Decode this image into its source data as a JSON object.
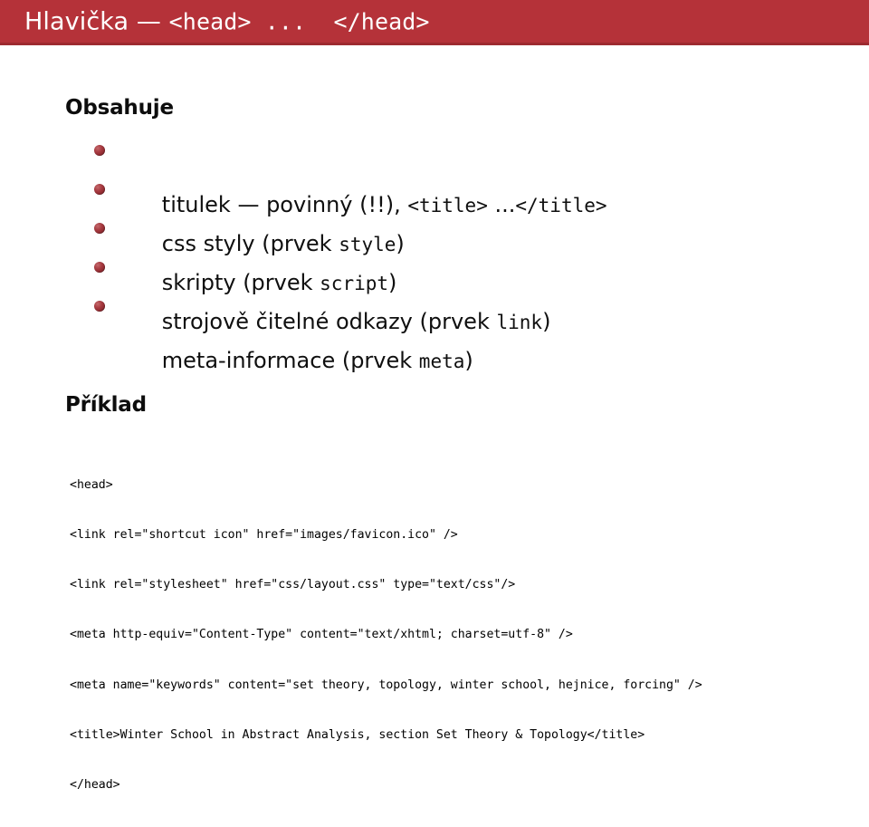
{
  "slide": {
    "title": {
      "prefix": "Hlavička — ",
      "open_tag": "<head>",
      "ellipsis": " ...  ",
      "close_tag": "</head>"
    },
    "bar_color": "#b53239",
    "bar_border_color": "#9d2a30",
    "bullet_color": "#8e2a30"
  },
  "sections": {
    "contains": {
      "heading": "Obsahuje",
      "items": [
        {
          "before": "titulek — povinný (!!), ",
          "code": "<title>",
          "after": " ...",
          "code2": "</title>",
          "after2": ""
        },
        {
          "before": "css styly (prvek ",
          "code": "style",
          "after": ")",
          "code2": "",
          "after2": ""
        },
        {
          "before": "skripty (prvek ",
          "code": "script",
          "after": ")",
          "code2": "",
          "after2": ""
        },
        {
          "before": "strojově čitelné odkazy (prvek ",
          "code": "link",
          "after": ")",
          "code2": "",
          "after2": ""
        },
        {
          "before": "meta-informace (prvek ",
          "code": "meta",
          "after": ")",
          "code2": "",
          "after2": ""
        }
      ]
    },
    "example": {
      "heading": "Příklad",
      "code_lines": [
        "<head>",
        "<link rel=\"shortcut icon\" href=\"images/favicon.ico\" />",
        "<link rel=\"stylesheet\" href=\"css/layout.css\" type=\"text/css\"/>",
        "<meta http-equiv=\"Content-Type\" content=\"text/xhtml; charset=utf-8\" />",
        "<meta name=\"keywords\" content=\"set theory, topology, winter school, hejnice, forcing\" />",
        "<title>Winter School in Abstract Analysis, section Set Theory & Topology</title>",
        "</head>"
      ]
    }
  }
}
